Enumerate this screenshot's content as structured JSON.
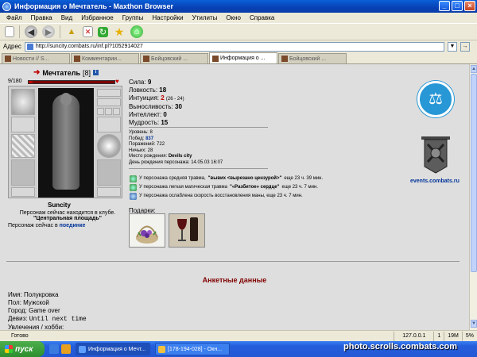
{
  "window": {
    "title": "Информация о Мечтатель - Maxthon Browser",
    "buttons": [
      "_",
      "□",
      "×"
    ]
  },
  "menu": [
    "Файл",
    "Правка",
    "Вид",
    "Избранное",
    "Группы",
    "Настройки",
    "Утилиты",
    "Окно",
    "Справка"
  ],
  "address": {
    "label": "Адрес",
    "url": "http://suncity.combats.ru/inf.pl?1052914027"
  },
  "tabs": [
    {
      "label": "Новости // S...",
      "active": false
    },
    {
      "label": "Комментарии...",
      "active": false
    },
    {
      "label": "Бойцовский ...",
      "active": false
    },
    {
      "label": "Информация о ...",
      "active": true
    },
    {
      "label": "Бойцовский ...",
      "active": false
    }
  ],
  "character": {
    "name": "Мечтатель",
    "level": "[8]",
    "hp": "9/180",
    "hp_fraction": 0.05,
    "city": "Suncity",
    "location_text": "Персонаж сейчас находится в клубе.",
    "location_place": "\"Центральная площадь\"",
    "duel_text": "Персонаж сейчас в",
    "duel_link": "поединке"
  },
  "stats": {
    "strength": {
      "label": "Сила:",
      "value": "9"
    },
    "agility": {
      "label": "Ловкость:",
      "value": "18"
    },
    "intuition": {
      "label": "Интуиция:",
      "value": "2",
      "extra": "(26 - 24)"
    },
    "endurance": {
      "label": "Выносливость:",
      "value": "30"
    },
    "intellect": {
      "label": "Интеллект:",
      "value": "0"
    },
    "wisdom": {
      "label": "Мудрость:",
      "value": "15"
    }
  },
  "info": {
    "level_label": "Уровень:",
    "level_value": "8",
    "wins_label": "Побед:",
    "wins_value": "837",
    "losses_label": "Поражений:",
    "losses_value": "722",
    "draws_label": "Ничьих:",
    "draws_value": "28",
    "birthplace_label": "Место рождения:",
    "birthplace_value": "Devils city",
    "birthday_label": "День рождения персонажа:",
    "birthday_value": "14.05.03 16:07"
  },
  "effects": [
    {
      "pre": "У персонажа средняя травма,",
      "name": "\"вывих <вырезано цензурой>\"",
      "post": "еще 23 ч. 39 мин."
    },
    {
      "pre": "У персонажа легкая магическая травма",
      "name": "\"«Разбитое» сердце\"",
      "post": "еще 23 ч. 7 мин."
    },
    {
      "pre": "У персонажа ослаблена скорость восстановления маны, еще 23 ч. 7 мин.",
      "name": "",
      "post": ""
    }
  ],
  "gifts_label": "Подарки:",
  "logos": {
    "events_label": "events.combats.ru"
  },
  "profile": {
    "title": "Анкетные данные",
    "name_label": "Имя:",
    "name_value": "Полукровка",
    "sex_label": "Пол:",
    "sex_value": "Мужской",
    "city_label": "Город:",
    "city_value": "Game over",
    "motto_label": "Девиз:",
    "motto_value": "Until next time",
    "hobby_label": "Увлечения / хобби:"
  },
  "statusbar": {
    "ready": "Готово",
    "ip": "127.0.0.1",
    "num": "1",
    "mem": "19M",
    "pct": "5%"
  },
  "taskbar": {
    "start": "пуск",
    "tasks": [
      "Информация о Мечт...",
      "[178-194-028] - Окн..."
    ],
    "watermark": "photo.scrolls.combats.com"
  },
  "colors": {
    "title_blue": "#0A5FD8",
    "page_bg": "#DEDEDE",
    "heading_red": "#800000",
    "link_blue": "#003399",
    "logo_blue": "#2797D6"
  }
}
